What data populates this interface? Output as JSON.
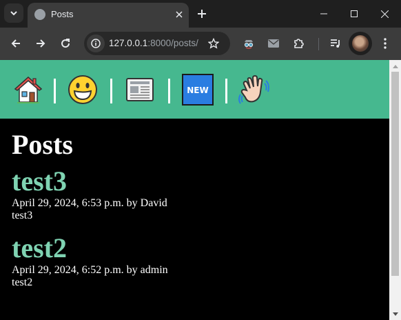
{
  "browser": {
    "tab": {
      "title": "Posts"
    },
    "url": {
      "host": "127.0.0.1",
      "rest": ":8000/posts/"
    }
  },
  "nav": {
    "items": [
      {
        "name": "home",
        "glyph": "🏠"
      },
      {
        "name": "smiley",
        "glyph": "😀"
      },
      {
        "name": "newspaper",
        "glyph": "📰"
      },
      {
        "name": "new",
        "label": "NEW"
      },
      {
        "name": "waving-hand",
        "glyph": "👋"
      }
    ],
    "separator": "|"
  },
  "page": {
    "title": "Posts",
    "posts": [
      {
        "title": "test3",
        "meta": "April 29, 2024, 6:53 p.m. by David",
        "body": "test3"
      },
      {
        "title": "test2",
        "meta": "April 29, 2024, 6:52 p.m. by admin",
        "body": "test2"
      }
    ]
  },
  "colors": {
    "nav_bg": "#46b88f",
    "post_title": "#7fd3b2",
    "page_bg": "#000000"
  }
}
